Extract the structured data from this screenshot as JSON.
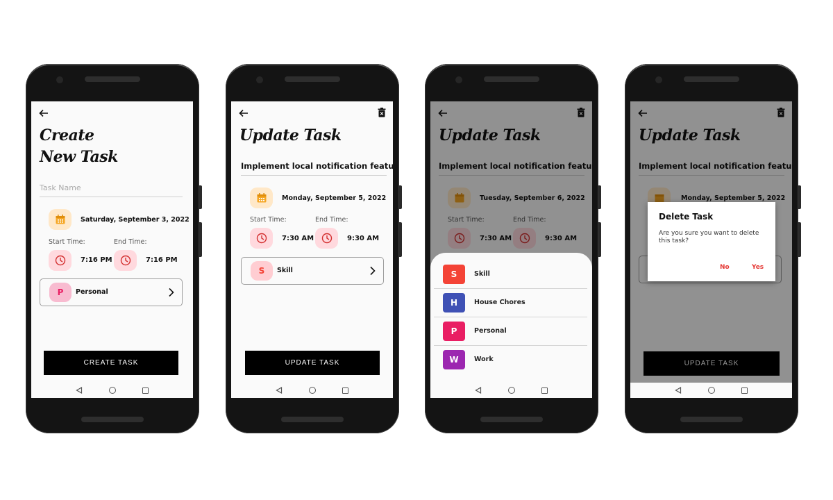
{
  "colors": {
    "accent_red": "#e53935",
    "calendar_tile": "#ffe8c8",
    "clock_tile": "#ffd9de",
    "button_black": "#000000"
  },
  "screens": [
    {
      "title_line1": "Create",
      "title_line2": "New Task",
      "task_placeholder": "Task Name",
      "date": "Saturday, September 3, 2022",
      "start_label": "Start Time:",
      "end_label": "End Time:",
      "start_time": "7:16 PM",
      "end_time": "7:16 PM",
      "category_letter": "P",
      "category_label": "Personal",
      "button_label": "CREATE TASK"
    },
    {
      "title": "Update Task",
      "task_name": "Implement local notification feature",
      "date": "Monday, September 5, 2022",
      "start_label": "Start Time:",
      "end_label": "End Time:",
      "start_time": "7:30 AM",
      "end_time": "9:30 AM",
      "category_letter": "S",
      "category_label": "Skill",
      "button_label": "UPDATE TASK"
    },
    {
      "title": "Update Task",
      "task_name": "Implement local notification feature",
      "date": "Tuesday, September 6, 2022",
      "start_label": "Start Time:",
      "end_label": "End Time:",
      "start_time": "7:30 AM",
      "end_time": "9:30 AM",
      "categories": [
        {
          "letter": "S",
          "label": "Skill",
          "color": "#f44336"
        },
        {
          "letter": "H",
          "label": "House Chores",
          "color": "#3f51b5"
        },
        {
          "letter": "P",
          "label": "Personal",
          "color": "#e91e63"
        },
        {
          "letter": "W",
          "label": "Work",
          "color": "#9c27b0"
        }
      ]
    },
    {
      "title": "Update Task",
      "task_name": "Implement local notification feature",
      "date": "Monday, September 5, 2022",
      "button_label": "UPDATE TASK",
      "dialog": {
        "title": "Delete Task",
        "message": "Are you sure you want to delete this task?",
        "no": "No",
        "yes": "Yes"
      }
    }
  ],
  "icons": {
    "back": "arrow-left-icon",
    "delete": "trash-icon",
    "calendar": "calendar-icon",
    "clock": "clock-icon",
    "chevron": "chevron-right-icon",
    "nav_back": "triangle-back-icon",
    "nav_home": "circle-home-icon",
    "nav_recent": "square-recent-icon"
  }
}
